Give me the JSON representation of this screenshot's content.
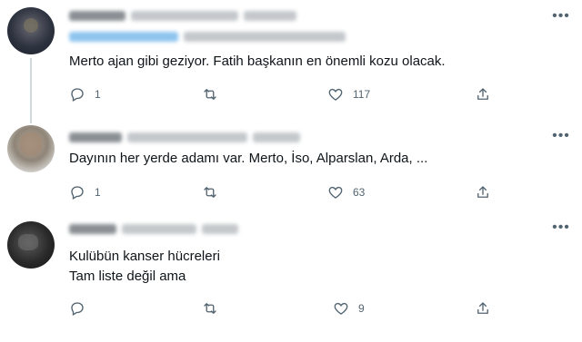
{
  "tweets": [
    {
      "text_lines": [
        "Merto ajan gibi geziyor. Fatih başkanın en önemli kozu olacak."
      ],
      "reply_count": "1",
      "retweet_count": "",
      "like_count": "117"
    },
    {
      "text_lines": [
        "Dayının her yerde adamı var. Merto, İso, Alparslan, Arda, ..."
      ],
      "reply_count": "1",
      "retweet_count": "",
      "like_count": "63"
    },
    {
      "text_lines": [
        "Kulübün kanser hücreleri",
        "Tam liste değil ama"
      ],
      "reply_count": "",
      "retweet_count": "",
      "like_count": "9"
    }
  ],
  "more_glyph": "•••",
  "colors": {
    "icon": "#536471",
    "text": "#0f1419",
    "thread_line": "#cfd9de",
    "link_blur": "#8ec4ee"
  },
  "icons": [
    "reply-icon",
    "retweet-icon",
    "like-icon",
    "share-icon",
    "more-icon"
  ]
}
